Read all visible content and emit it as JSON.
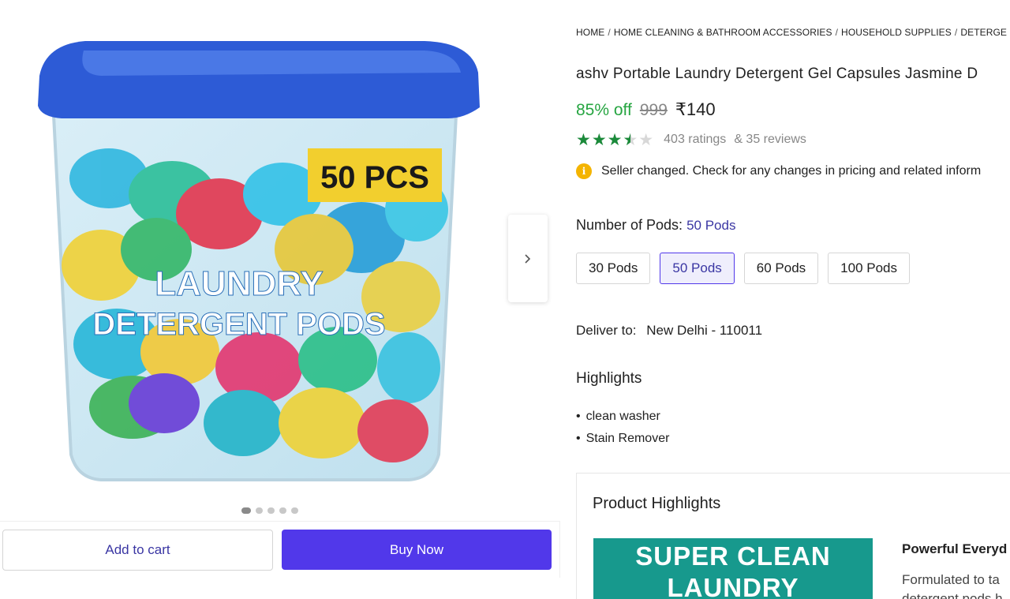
{
  "gallery": {
    "image_badge": "50 PCS",
    "image_label_line1": "LAUNDRY",
    "image_label_line2": "DETERGENT PODS",
    "next_icon": "chevron-right-icon",
    "dot_count": 5,
    "active_dot": 0
  },
  "actions": {
    "add_to_cart": "Add to cart",
    "buy_now": "Buy Now"
  },
  "breadcrumb": [
    "HOME",
    "HOME CLEANING & BATHROOM ACCESSORIES",
    "HOUSEHOLD SUPPLIES",
    "DETERGE"
  ],
  "product": {
    "title": "ashv Portable Laundry Detergent Gel Capsules Jasmine D",
    "discount": "85% off",
    "mrp": "999",
    "price": "₹140",
    "rating": 3.5,
    "ratings_count": "403 ratings",
    "reviews_count": "& 35 reviews"
  },
  "notice": {
    "icon": "info-icon",
    "text": "Seller changed. Check for any changes in pricing and related inform"
  },
  "variants": {
    "label": "Number of Pods:",
    "selected_value": "50 Pods",
    "options": [
      "30 Pods",
      "50 Pods",
      "60 Pods",
      "100 Pods"
    ],
    "selected_index": 1
  },
  "delivery": {
    "label": "Deliver to:",
    "location": "New Delhi - 110011"
  },
  "highlights": {
    "title": "Highlights",
    "items": [
      "clean washer",
      "Stain Remover"
    ]
  },
  "product_highlights": {
    "title": "Product Highlights",
    "banner_line1": "SUPER CLEAN",
    "banner_line2": "LAUNDRY",
    "side_title": "Powerful Everyd",
    "side_text_line1": "Formulated to ta",
    "side_text_line2": "detergent pods h"
  },
  "colors": {
    "accent": "#5138ea",
    "discount": "#26a541",
    "star": "#1b8a3a",
    "info": "#f4b400",
    "banner": "#17998d"
  }
}
